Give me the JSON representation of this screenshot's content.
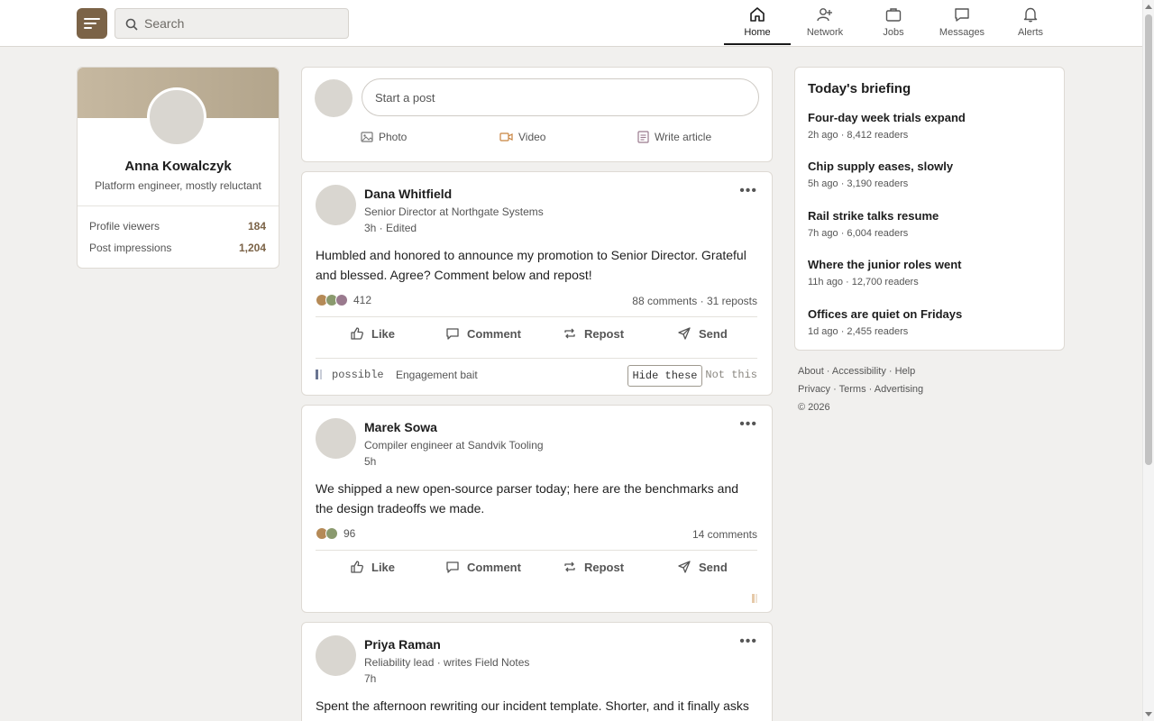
{
  "header": {
    "search_placeholder": "Search",
    "nav": [
      {
        "label": "Home",
        "icon": "home-icon",
        "active": true
      },
      {
        "label": "Network",
        "icon": "add-person-icon",
        "active": false
      },
      {
        "label": "Jobs",
        "icon": "briefcase-icon",
        "active": false
      },
      {
        "label": "Messages",
        "icon": "chat-icon",
        "active": false
      },
      {
        "label": "Alerts",
        "icon": "bell-icon",
        "active": false
      }
    ]
  },
  "profile": {
    "name": "Anna Kowalczyk",
    "tagline": "Platform engineer, mostly reluctant",
    "stats": [
      {
        "label": "Profile viewers",
        "value": "184"
      },
      {
        "label": "Post impressions",
        "value": "1,204"
      }
    ]
  },
  "composer": {
    "placeholder": "Start a post",
    "actions": [
      {
        "label": "Photo",
        "icon": "photo-icon"
      },
      {
        "label": "Video",
        "icon": "video-icon"
      },
      {
        "label": "Write article",
        "icon": "article-icon"
      }
    ]
  },
  "post_actions": [
    "Like",
    "Comment",
    "Repost",
    "Send"
  ],
  "posts": [
    {
      "author": "Dana Whitfield",
      "headline": "Senior Director at Northgate Systems",
      "meta": "3h · Edited",
      "body": "Humbled and honored to announce my promotion to Senior Director. Grateful and blessed. Agree? Comment below and repost!",
      "reactions": "412",
      "stats": "88 comments · 31 reposts",
      "flag": {
        "level": "possible",
        "label": "Engagement bait",
        "hide": "Hide these",
        "dismiss": "Not this"
      }
    },
    {
      "author": "Marek Sowa",
      "headline": "Compiler engineer at Sandvik Tooling",
      "meta": "5h",
      "body": "We shipped a new open-source parser today; here are the benchmarks and the design tradeoffs we made.",
      "reactions": "96",
      "stats": "14 comments"
    },
    {
      "author": "Priya Raman",
      "headline": "Reliability lead · writes Field Notes",
      "meta": "7h",
      "body": "Spent the afternoon rewriting our incident template. Shorter, and it finally asks what we actually want to learn after each one."
    }
  ],
  "briefing": {
    "title": "Today's briefing",
    "items": [
      {
        "headline": "Four-day week trials expand",
        "meta": "2h ago · 8,412 readers"
      },
      {
        "headline": "Chip supply eases, slowly",
        "meta": "5h ago · 3,190 readers"
      },
      {
        "headline": "Rail strike talks resume",
        "meta": "7h ago · 6,004 readers"
      },
      {
        "headline": "Where the junior roles went",
        "meta": "11h ago · 12,700 readers"
      },
      {
        "headline": "Offices are quiet on Fridays",
        "meta": "1d ago · 2,455 readers"
      }
    ]
  },
  "footer": {
    "line1": "About · Accessibility · Help",
    "line2": "Privacy · Terms · Advertising",
    "line3": "© 2026"
  },
  "colors": {
    "brand": "#7b6347",
    "page_bg": "#f1f0ee",
    "flag_bar": "#6a7591",
    "reaction_1": "#b58a57",
    "reaction_2": "#8a9a6e",
    "reaction_3": "#9a7a8e",
    "soft_mark": "#e6c9a8"
  }
}
